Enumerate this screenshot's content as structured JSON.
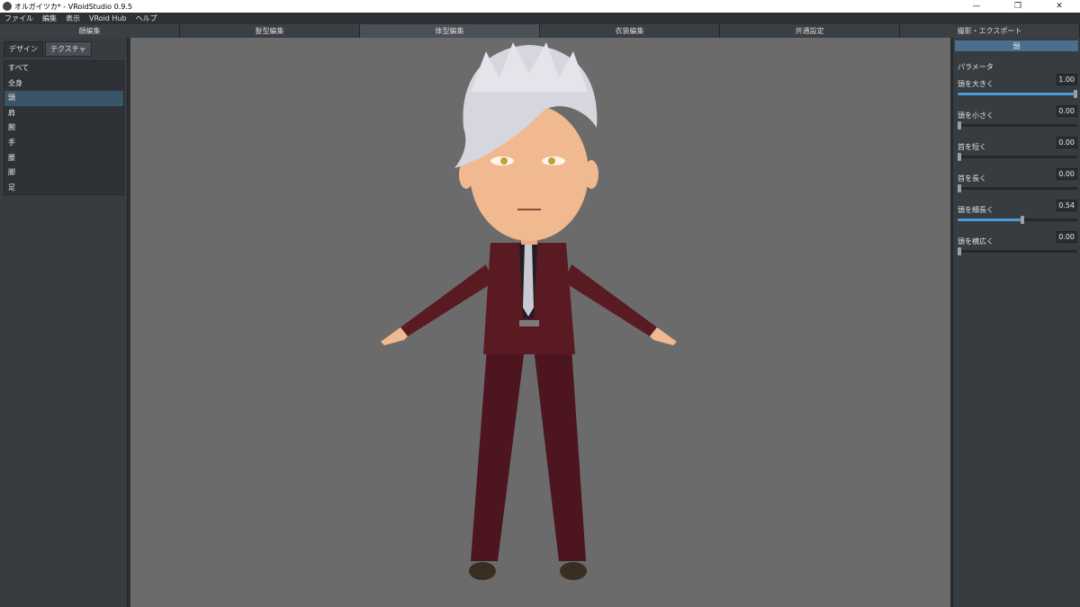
{
  "window": {
    "title": "オルガイツカ* - VRoidStudio 0.9.5",
    "controls": [
      "—",
      "❐",
      "✕"
    ]
  },
  "menu": [
    "ファイル",
    "編集",
    "表示",
    "VRoid Hub",
    "ヘルプ"
  ],
  "main_tabs": [
    {
      "label": "顔編集",
      "active": false
    },
    {
      "label": "髪型編集",
      "active": false
    },
    {
      "label": "体型編集",
      "active": true
    },
    {
      "label": "衣装編集",
      "active": false
    },
    {
      "label": "共通設定",
      "active": false
    },
    {
      "label": "撮影・エクスポート",
      "active": false
    }
  ],
  "left": {
    "subtabs": [
      {
        "label": "デザイン",
        "active": false
      },
      {
        "label": "テクスチャ",
        "active": true
      }
    ],
    "categories": [
      {
        "label": "すべて",
        "active": false
      },
      {
        "label": "全身",
        "active": false
      },
      {
        "label": "頭",
        "active": true
      },
      {
        "label": "肩",
        "active": false
      },
      {
        "label": "腕",
        "active": false
      },
      {
        "label": "手",
        "active": false
      },
      {
        "label": "腰",
        "active": false
      },
      {
        "label": "脚",
        "active": false
      },
      {
        "label": "足",
        "active": false
      }
    ]
  },
  "right": {
    "section": "頭",
    "params_label": "パラメータ",
    "params": [
      {
        "label": "頭を大きく",
        "value": "1.00",
        "fraction": 1.0
      },
      {
        "label": "頭を小さく",
        "value": "0.00",
        "fraction": 0.0
      },
      {
        "label": "首を短く",
        "value": "0.00",
        "fraction": 0.0
      },
      {
        "label": "首を長く",
        "value": "0.00",
        "fraction": 0.0
      },
      {
        "label": "頭を細長く",
        "value": "0.54",
        "fraction": 0.54
      },
      {
        "label": "頭を横広く",
        "value": "0.00",
        "fraction": 0.0
      }
    ]
  },
  "colors": {
    "accent": "#4b9ad8",
    "suit": "#5a1a22",
    "skin": "#f0b98f",
    "hair": "#d6d6de",
    "viewport_bg": "#6b6b6b"
  }
}
